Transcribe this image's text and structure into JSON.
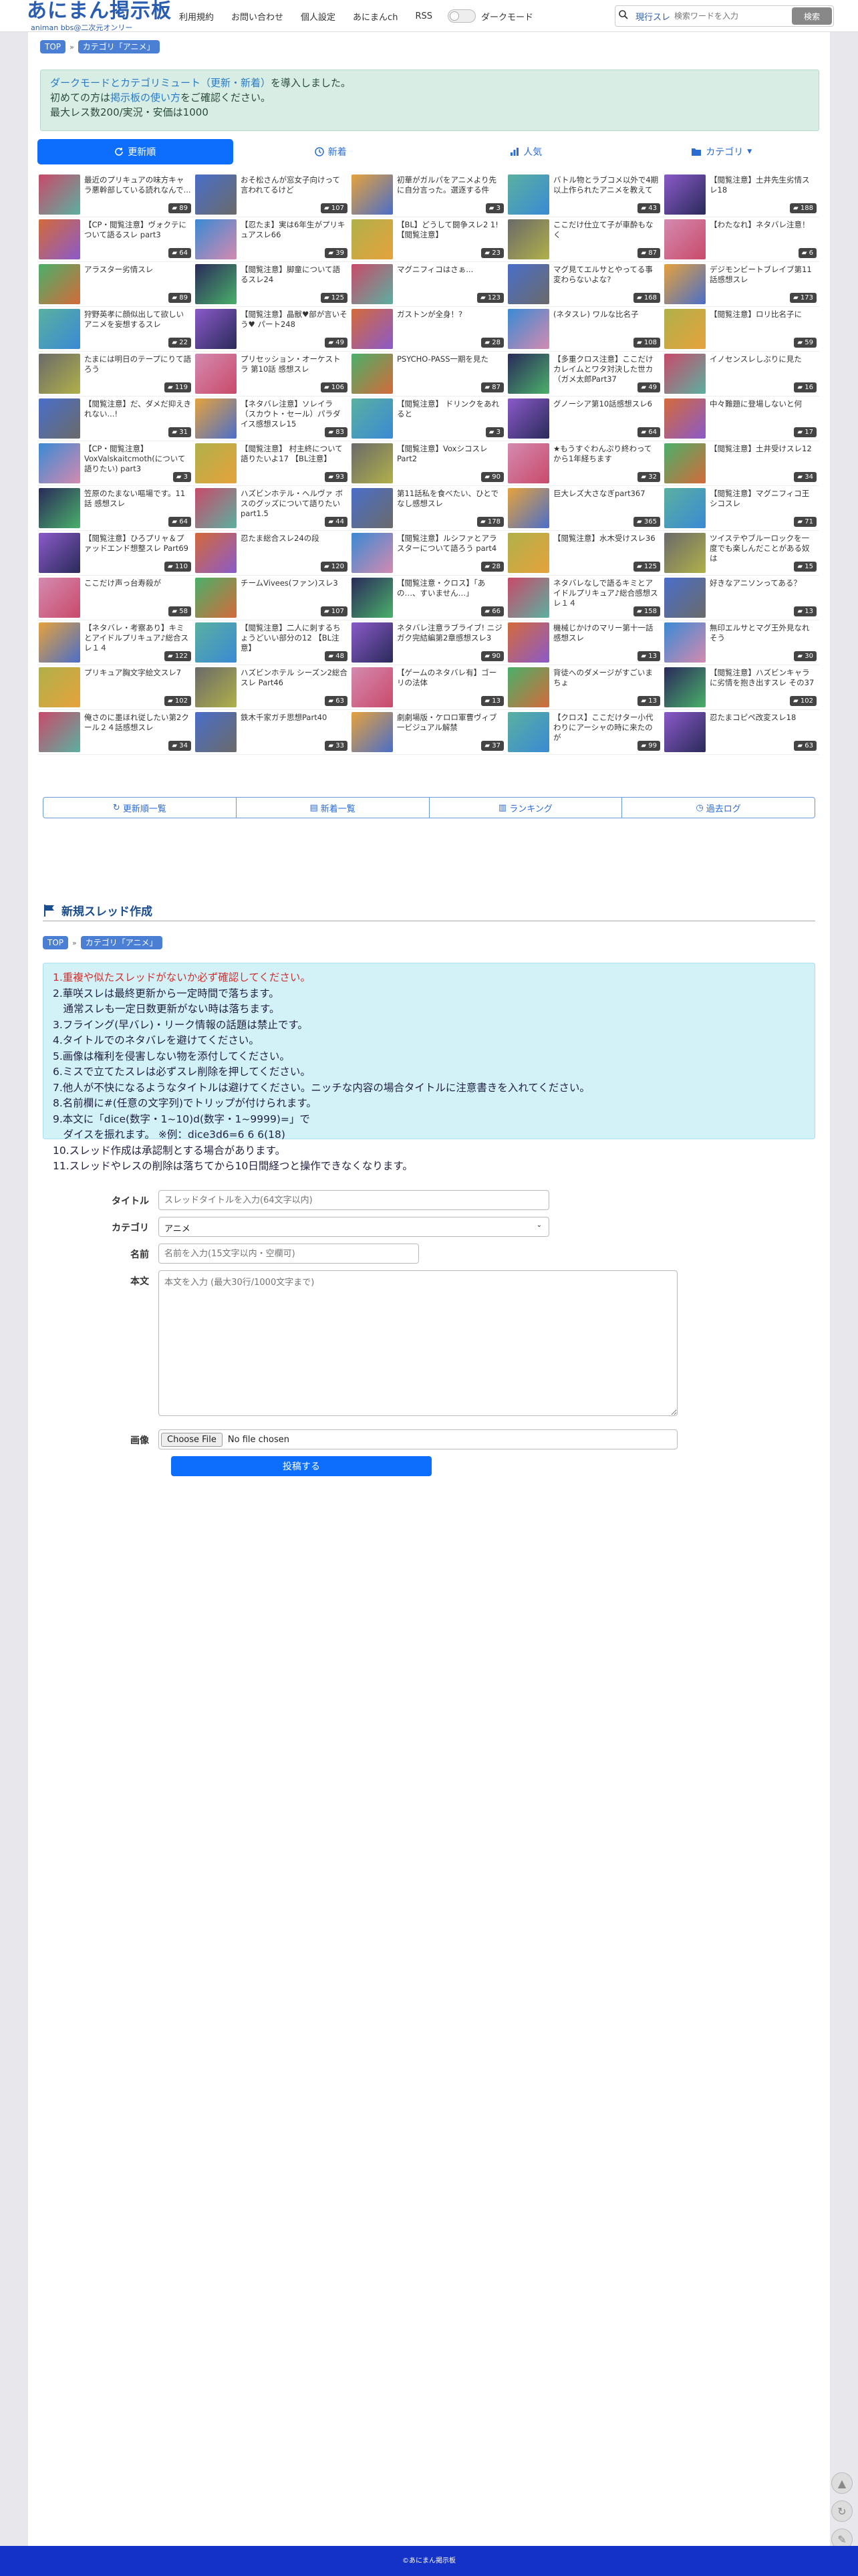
{
  "header": {
    "logo_main": "あにまん掲示板",
    "logo_sub": "animan bbs@二次元オンリー",
    "nav": [
      "利用規約",
      "お問い合わせ",
      "個人設定",
      "あにまんch",
      "RSS"
    ],
    "dark_mode_label": "ダークモード",
    "search_scope": "現行スレ",
    "search_placeholder": "検索ワードを入力",
    "search_button": "検索"
  },
  "breadcrumb": [
    "TOP",
    "カテゴリ「アニメ」"
  ],
  "notice": {
    "line1_link": "ダークモードとカテゴリミュート（更新・新着）",
    "line1_rest": "を導入しました。",
    "line2_pre": "初めての方は",
    "line2_link": "掲示板の使い方",
    "line2_rest": "をご確認ください。",
    "line3": "最大レス数200/実況・安価は1000"
  },
  "tabs": [
    "更新順",
    "新着",
    "人気",
    "カテゴリ"
  ],
  "threads": [
    {
      "t": "最近のプリキュアの味方キャラ悪幹部している読れなんで...",
      "n": "89"
    },
    {
      "t": "おそ松さんが窓女子向けって言われてるけど",
      "n": "107"
    },
    {
      "t": "初華がガルパをアニメより先に自分言った。選逐する件",
      "n": "3"
    },
    {
      "t": "バトル物とラブコメ以外で4期以上作られたアニメを教えて",
      "n": "43"
    },
    {
      "t": "【閲覧注意】土井先生劣情スレ18",
      "n": "188"
    },
    {
      "t": "【CP・閲覧注意】ヴォクテについて語るスレ part3",
      "n": "64"
    },
    {
      "t": "【忍たま】実は6年生がプリキュアスレ66",
      "n": "39"
    },
    {
      "t": "【BL】どうして闘争スレ2 1!【閲覧注意】",
      "n": "23"
    },
    {
      "t": "ここだけ仕立て子が車酔もなく",
      "n": "87"
    },
    {
      "t": "【わたなれ】ネタバレ注意！",
      "n": "6"
    },
    {
      "t": "アラスター劣情スレ",
      "n": "89"
    },
    {
      "t": "【閲覧注意】脚童について語るスレ24",
      "n": "125"
    },
    {
      "t": "マグニフィコはさぁ...",
      "n": "123"
    },
    {
      "t": "マグ見てエルサとやってる事変わらないよな?",
      "n": "168"
    },
    {
      "t": "デジモンビートブレイブ第11話感想スレ",
      "n": "173"
    },
    {
      "t": "狩野英孝に顔似出して欲しいアニメを妄想するスレ",
      "n": "22"
    },
    {
      "t": "【閲覧注意】晶獣♥部が言いそう♥ パート248",
      "n": "49"
    },
    {
      "t": "ガストンが全身！?",
      "n": "28"
    },
    {
      "t": "(ネタスレ) ワルな比名子",
      "n": "108"
    },
    {
      "t": "【閲覧注意】ロリ比名子に",
      "n": "59"
    },
    {
      "t": "たまには明日のテープにりて語ろう",
      "n": "119"
    },
    {
      "t": "プリセッション・オーケストラ 第10話 感想スレ",
      "n": "106"
    },
    {
      "t": "PSYCHO-PASS一期を見た",
      "n": "87"
    },
    {
      "t": "【多重クロス注意】ここだけカレイムとワタ対決した世カ（ガメ太郎Part37",
      "n": "49"
    },
    {
      "t": "イノセンスレしぶりに見た",
      "n": "16"
    },
    {
      "t": "【閲覧注意】だ、ダメだ抑えきれない...!",
      "n": "31"
    },
    {
      "t": "【ネタバレ注意】ソレイラ（スカウト・セール）パラダイス感想スレ15",
      "n": "83"
    },
    {
      "t": "【閲覧注意】 ドリンクをあれると",
      "n": "3"
    },
    {
      "t": "グノーシア第10話感想スレ6",
      "n": "64"
    },
    {
      "t": "中々難題に登場しないと何",
      "n": "17"
    },
    {
      "t": "【CP・閲覧注意】VoxValskaitcmoth(について語りたい) part3",
      "n": "3"
    },
    {
      "t": "【閲覧注意】 村主終について語りたいよ17 【BL注意】",
      "n": "93"
    },
    {
      "t": "【閲覧注意】VoxシコスレPart2",
      "n": "90"
    },
    {
      "t": "★もうすぐわんぷり終わって から1年経ちます",
      "n": "32"
    },
    {
      "t": "【閲覧注意】土井受けスレ12",
      "n": "34"
    },
    {
      "t": "笠原のたまない嘔場です。11話 感想スレ",
      "n": "64"
    },
    {
      "t": "ハズビンホテル・ヘルヴァ ボスのグッズについて語りたい part1.5",
      "n": "44"
    },
    {
      "t": "第11話私を食べたい、ひとでなし感想スレ",
      "n": "178"
    },
    {
      "t": "巨大レズ大さなぎpart367",
      "n": "365"
    },
    {
      "t": "【閲覧注意】マグニフィコ王シコスレ",
      "n": "71"
    },
    {
      "t": "【閲覧注意】ひろプリャ＆プァッドエンド想整スレ Part69",
      "n": "110"
    },
    {
      "t": "忍たま総合スレ24の段",
      "n": "120"
    },
    {
      "t": "【閲覧注意】ルシファとアラスターについて語ろう part4",
      "n": "28"
    },
    {
      "t": "【閲覧注意】水木受けスレ36",
      "n": "125"
    },
    {
      "t": "ツイステやブルーロックを一度でも楽しんだことがある奴は",
      "n": "15"
    },
    {
      "t": "ここだけ声っ台寿殺が",
      "n": "58"
    },
    {
      "t": "チームVivees(ファン)スレ3",
      "n": "107"
    },
    {
      "t": "【閲覧注意・クロス】「あの…、すいません…」",
      "n": "66"
    },
    {
      "t": "ネタバレなしで語るキミとアイドルプリキュア♪総合感想スレ１４",
      "n": "158"
    },
    {
      "t": "好きなアニソンってある？",
      "n": "13"
    },
    {
      "t": "【ネタバレ・考察あり】キミとアイドルプリキュア♪総合スレ１４",
      "n": "122"
    },
    {
      "t": "【閲覧注意】二人に刺するちょうどいい部分の12 【BL注意】",
      "n": "48"
    },
    {
      "t": "ネタバレ注意ラブライブ! ニジガク完結編第2章感想スレ3",
      "n": "90"
    },
    {
      "t": "機械じかけのマリー第十一話感想スレ",
      "n": "13"
    },
    {
      "t": "無印エルサとマグ王外見なれそう",
      "n": "30"
    },
    {
      "t": "プリキュア胸文字絵文スレ7",
      "n": "102"
    },
    {
      "t": "ハズビンホテル シーズン2総合スレ Part46",
      "n": "63"
    },
    {
      "t": "【ゲームのネタバレ有】ゴーリの法体",
      "n": "13"
    },
    {
      "t": "背徒へのダメージがすごいまちょ",
      "n": "13"
    },
    {
      "t": "【閲覧注意】ハズビンキャラに劣情を抱き出すスレ その37",
      "n": "102"
    },
    {
      "t": "俺さのに墨ほれ従したい第2クール２４話感想スレ",
      "n": "34"
    },
    {
      "t": "鉄木千家ガチ思想Part40",
      "n": "33"
    },
    {
      "t": "劇劇場版・ケロロ軍曹ヴィブ一ビジュアル解禁",
      "n": "37"
    },
    {
      "t": "【クロス】ここだけター小代わりにアーシャの時に来たのが",
      "n": "99"
    },
    {
      "t": "忍たまコピペ改変スレ18",
      "n": "63"
    }
  ],
  "bottom_links": [
    "更新順一覧",
    "新着一覧",
    "ランキング",
    "過去ログ"
  ],
  "new_thread": {
    "heading": "新規スレッド作成",
    "rules_red": "1.重複や似たスレッドがないか必ず確認してください。",
    "rules": [
      "2.華咲スレは最終更新から一定時間で落ちます。",
      "　通常スレも一定日数更新がない時は落ちます。",
      "3.フライング(早バレ)・リーク情報の話題は禁止です。",
      "4.タイトルでのネタバレを避けてください。",
      "5.画像は権利を侵害しない物を添付してください。",
      "6.ミスで立てたスレは必ずスレ削除を押してください。",
      "7.他人が不快になるようなタイトルは避けてください。ニッチな内容の場合タイトルに注意書きを入れてください。",
      "8.名前欄に#(任意の文字列)でトリップが付けられます。",
      "9.本文に「dice(数字・1~10)d(数字・1~9999)=」で",
      "　ダイスを振れます。 ※例：dice3d6=6 6 6(18)",
      "10.スレッド作成は承認制とする場合があります。",
      "11.スレッドやレスの削除は落ちてから10日間経つと操作できなくなります。"
    ],
    "labels": {
      "title": "タイトル",
      "category": "カテゴリ",
      "name": "名前",
      "body": "本文",
      "image": "画像"
    },
    "title_placeholder": "スレッドタイトルを入力(64文字以内)",
    "category_value": "アニメ",
    "name_placeholder": "名前を入力(15文字以内・空欄可)",
    "body_placeholder": "本文を入力 (最大30行/1000文字まで)",
    "file_button": "Choose File",
    "file_status": "No file chosen",
    "submit": "投稿する"
  },
  "footer": "©あにまん掲示板"
}
